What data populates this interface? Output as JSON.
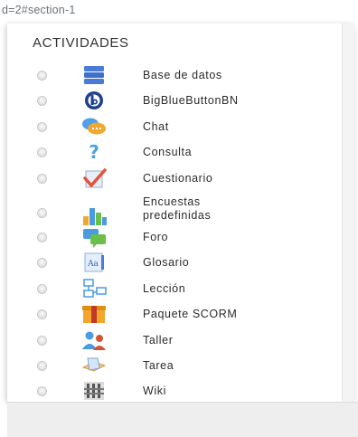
{
  "url_fragment": "d=2#section-1",
  "section": {
    "heading": "ACTIVIDADES"
  },
  "activities": [
    {
      "label": "Base de datos",
      "icon": "database-icon"
    },
    {
      "label": "BigBlueButtonBN",
      "icon": "bigbluebutton-icon"
    },
    {
      "label": "Chat",
      "icon": "chat-icon"
    },
    {
      "label": "Consulta",
      "icon": "choice-question-icon"
    },
    {
      "label": "Cuestionario",
      "icon": "quiz-checkmark-icon"
    },
    {
      "label": "Encuestas predefinidas",
      "icon": "survey-chart-icon"
    },
    {
      "label": "Foro",
      "icon": "forum-icon"
    },
    {
      "label": "Glosario",
      "icon": "glossary-icon"
    },
    {
      "label": "Lección",
      "icon": "lesson-icon"
    },
    {
      "label": "Paquete SCORM",
      "icon": "scorm-package-icon"
    },
    {
      "label": "Taller",
      "icon": "workshop-icon"
    },
    {
      "label": "Tarea",
      "icon": "assignment-icon"
    },
    {
      "label": "Wiki",
      "icon": "wiki-icon"
    }
  ]
}
